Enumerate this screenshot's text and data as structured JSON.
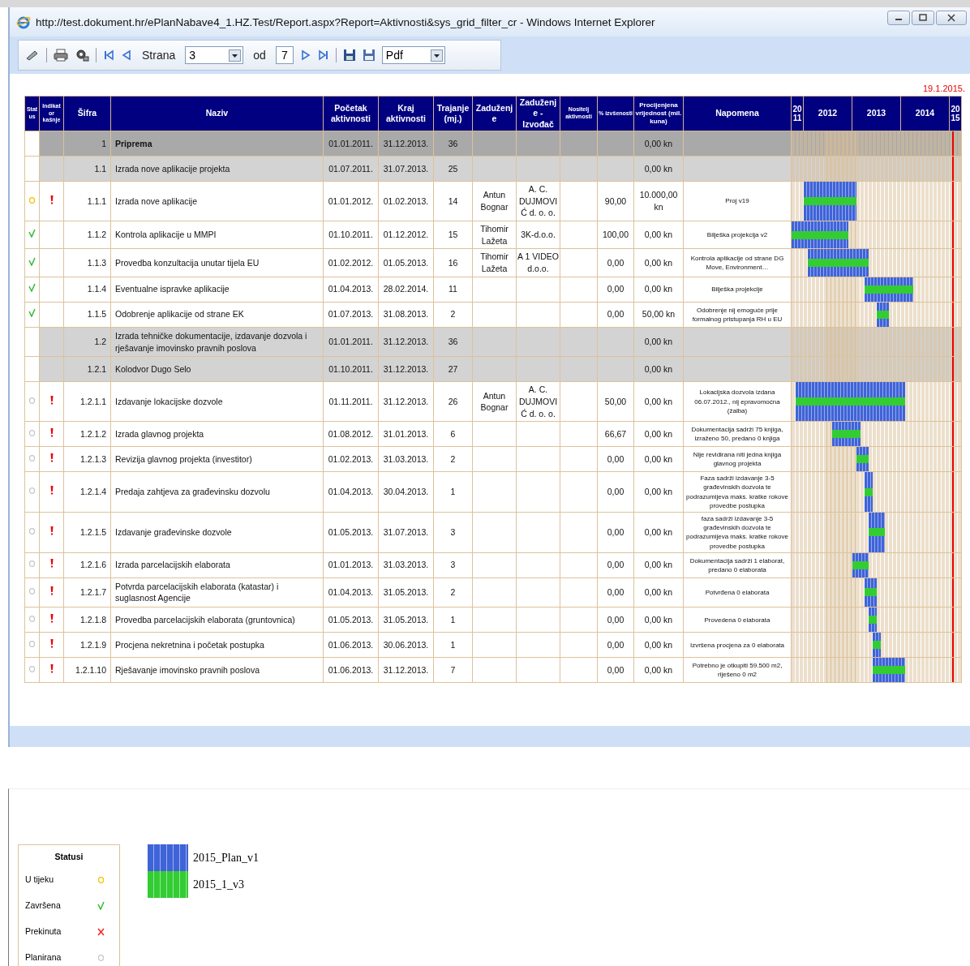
{
  "window": {
    "title": "http://test.dokument.hr/ePlanNabave4_1.HZ.Test/Report.aspx?Report=Aktivnosti&sys_grid_filter_cr - Windows Internet Explorer"
  },
  "toolbar": {
    "page_label": "Strana",
    "page": "3",
    "of_label": "od",
    "page_count": "7",
    "format": "Pdf"
  },
  "report_date": "19.1.2015.",
  "table": {
    "columns": [
      "Stat us",
      "Indikat or kašnje",
      "Šifra",
      "Naziv",
      "Početak aktivnosti",
      "Kraj aktivnosti",
      "Trajanje (mj.)",
      "Zaduženje",
      "Zaduženje - Izvođač",
      "Nositelj aktivnosti",
      "% izvšenosti",
      "Procijenjena vrijednost (mil. kuna)",
      "Napomena"
    ],
    "rows": [
      {
        "code": "1",
        "name": "Priprema",
        "start": "01.01.2011.",
        "end": "31.12.2013.",
        "duration": "36",
        "value": "0,00 kn",
        "children": [
          {
            "code": "1.1",
            "name": "Izrada nove aplikacije projekta",
            "start": "01.07.2011.",
            "end": "31.07.2013.",
            "duration": "25",
            "value": "0,00 kn",
            "children": [
              {
                "code": "1.1.1",
                "kind": "in_progress",
                "late": true,
                "name": "Izrada nove aplikacije",
                "start": "01.01.2012.",
                "end": "01.02.2013.",
                "duration": "14",
                "assignee": "Antun Bognar",
                "contractor": "A. C. DUJMOVIĆ d. o. o.",
                "percent": "90,00",
                "value": "10.000,00 kn",
                "note": "Proj v19"
              },
              {
                "code": "1.1.2",
                "kind": "done",
                "late": false,
                "name": "Kontrola aplikacije u MMPI",
                "start": "01.10.2011.",
                "end": "01.12.2012.",
                "duration": "15",
                "assignee": "Tihomir Lažeta",
                "contractor": "3K-d.o.o.",
                "percent": "100,00",
                "value": "0,00 kn",
                "note": "Bilješka projekcija v2"
              },
              {
                "code": "1.1.3",
                "kind": "done",
                "late": false,
                "name": "Provedba konzultacija unutar tijela EU",
                "start": "01.02.2012.",
                "end": "01.05.2013.",
                "duration": "16",
                "assignee": "Tihomir Lažeta",
                "contractor": "A 1 VIDEO d.o.o.",
                "percent": "0,00",
                "value": "0,00 kn",
                "note": "Kontrola aplikacije od strane DG Move, Environment…"
              },
              {
                "code": "1.1.4",
                "kind": "done",
                "late": false,
                "name": "Eventualne ispravke aplikacije",
                "start": "01.04.2013.",
                "end": "28.02.2014.",
                "duration": "11",
                "percent": "0,00",
                "value": "0,00 kn",
                "note": "Bilješka projekcije"
              },
              {
                "code": "1.1.5",
                "kind": "done",
                "late": false,
                "name": "Odobrenje aplikacije od strane EK",
                "start": "01.07.2013.",
                "end": "31.08.2013.",
                "duration": "2",
                "percent": "0,00",
                "value": "50,00 kn",
                "note": "Odobrenje nij emoguće prije formalnog pristupanja RH u EU"
              }
            ]
          },
          {
            "code": "1.2",
            "name": "Izrada tehničke dokumentacije, izdavanje dozvola i rješavanje imovinsko pravnih poslova",
            "start": "01.01.2011.",
            "end": "31.12.2013.",
            "duration": "36",
            "value": "0,00 kn",
            "children": [
              {
                "code": "1.2.1",
                "name": "Kolodvor Dugo Selo",
                "start": "01.10.2011.",
                "end": "31.12.2013.",
                "duration": "27",
                "value": "0,00 kn",
                "children": [
                  {
                    "code": "1.2.1.1",
                    "kind": "planned",
                    "late": true,
                    "name": "Izdavanje lokacijske dozvole",
                    "start": "01.11.2011.",
                    "end": "31.12.2013.",
                    "duration": "26",
                    "assignee": "Antun Bognar",
                    "contractor": "A. C. DUJMOVIĆ d. o. o.",
                    "percent": "50,00",
                    "value": "0,00 kn",
                    "note": "Lokacijska dozvola izdana 06.07.2012., nij epravomoćna (žalba)"
                  },
                  {
                    "code": "1.2.1.2",
                    "kind": "planned",
                    "late": true,
                    "name": "Izrada glavnog projekta",
                    "start": "01.08.2012.",
                    "end": "31.01.2013.",
                    "duration": "6",
                    "percent": "66,67",
                    "value": "0,00 kn",
                    "note": "Dokumentacija sadrži 75 knjiga, izraženo 50, predano 0 knjiga"
                  },
                  {
                    "code": "1.2.1.3",
                    "kind": "planned",
                    "late": true,
                    "name": "Revizija glavnog projekta (investitor)",
                    "start": "01.02.2013.",
                    "end": "31.03.2013.",
                    "duration": "2",
                    "percent": "0,00",
                    "value": "0,00 kn",
                    "note": "Nije revidirana niti jedna knjiga glavnog projekta"
                  },
                  {
                    "code": "1.2.1.4",
                    "kind": "planned",
                    "late": true,
                    "name": "Predaja zahtjeva za građevinsku dozvolu",
                    "start": "01.04.2013.",
                    "end": "30.04.2013.",
                    "duration": "1",
                    "percent": "0,00",
                    "value": "0,00 kn",
                    "note": "Faza sadrži izdavanje 3-5 građevinskih dozvola te podrazumijeva maks. kratke rokove provedbe postupka"
                  },
                  {
                    "code": "1.2.1.5",
                    "kind": "planned",
                    "late": true,
                    "name": "Izdavanje građevinske dozvole",
                    "start": "01.05.2013.",
                    "end": "31.07.2013.",
                    "duration": "3",
                    "percent": "0,00",
                    "value": "0,00 kn",
                    "note": "faza sadrži izdavanje 3-5 građevinskih dozvola te podrazumijeva maks. kratke rokove provedbe postupka"
                  },
                  {
                    "code": "1.2.1.6",
                    "kind": "planned",
                    "late": true,
                    "name": "Izrada parcelacijskih elaborata",
                    "start": "01.01.2013.",
                    "end": "31.03.2013.",
                    "duration": "3",
                    "percent": "0,00",
                    "value": "0,00 kn",
                    "note": "Dokumentacija sadrži 1 elaborat, predano 0 elaborata"
                  },
                  {
                    "code": "1.2.1.7",
                    "kind": "planned",
                    "late": true,
                    "name": "Potvrda parcelacijskih elaborata (katastar) i suglasnost Agencije",
                    "start": "01.04.2013.",
                    "end": "31.05.2013.",
                    "duration": "2",
                    "percent": "0,00",
                    "value": "0,00 kn",
                    "note": "Potvrđena 0 elaborata"
                  },
                  {
                    "code": "1.2.1.8",
                    "kind": "planned",
                    "late": true,
                    "name": "Provedba parcelacijskih elaborata (gruntovnica)",
                    "start": "01.05.2013.",
                    "end": "31.05.2013.",
                    "duration": "1",
                    "percent": "0,00",
                    "value": "0,00 kn",
                    "note": "Provedena 0 elaborata"
                  },
                  {
                    "code": "1.2.1.9",
                    "kind": "planned",
                    "late": true,
                    "name": "Procjena nekretnina i početak postupka",
                    "start": "01.06.2013.",
                    "end": "30.06.2013.",
                    "duration": "1",
                    "percent": "0,00",
                    "value": "0,00 kn",
                    "note": "Izvršena procjena za 0 elaborata"
                  },
                  {
                    "code": "1.2.1.10",
                    "kind": "planned",
                    "late": true,
                    "name": "Rješavanje imovinsko pravnih poslova",
                    "start": "01.06.2013.",
                    "end": "31.12.2013.",
                    "duration": "7",
                    "percent": "0,00",
                    "value": "0,00 kn",
                    "note": "Potrebno je otkupiti 59.500 m2, riješeno 0 m2"
                  }
                ]
              }
            ]
          }
        ]
      }
    ],
    "years": [
      "20 11",
      "2012",
      "2013",
      "2014",
      "20 15"
    ]
  },
  "status_legend": {
    "title": "Statusi",
    "items": [
      {
        "label": "U tijeku",
        "kind": "in_progress"
      },
      {
        "label": "Završena",
        "kind": "done"
      },
      {
        "label": "Prekinuta",
        "kind": "interrupted"
      },
      {
        "label": "Planirana",
        "kind": "planned"
      }
    ]
  },
  "plan_legend": [
    {
      "label": "2015_Plan_v1",
      "color": "#3f63d8"
    },
    {
      "label": "2015_1_v3",
      "color": "#33cc33"
    }
  ]
}
